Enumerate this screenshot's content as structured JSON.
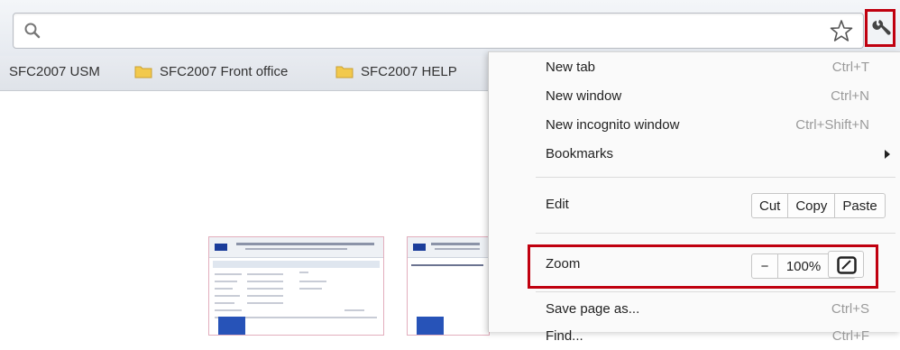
{
  "bookmarks": [
    {
      "label": "SFC2007 USM",
      "icon": "none"
    },
    {
      "label": "SFC2007 Front office",
      "icon": "folder-icon"
    },
    {
      "label": "SFC2007 HELP",
      "icon": "folder-icon"
    }
  ],
  "menu": {
    "new_tab": {
      "label": "New tab",
      "shortcut": "Ctrl+T"
    },
    "new_window": {
      "label": "New window",
      "shortcut": "Ctrl+N"
    },
    "new_incognito": {
      "label": "New incognito window",
      "shortcut": "Ctrl+Shift+N"
    },
    "bookmarks": {
      "label": "Bookmarks"
    },
    "edit": {
      "label": "Edit",
      "cut": "Cut",
      "copy": "Copy",
      "paste": "Paste"
    },
    "zoom": {
      "label": "Zoom",
      "minus": "−",
      "level": "100%",
      "plus": "+"
    },
    "save_page": {
      "label": "Save page as...",
      "shortcut": "Ctrl+S"
    },
    "find": {
      "label": "Find...",
      "shortcut": "Ctrl+F"
    }
  },
  "colors": {
    "highlight": "#c0000f",
    "toolbar": "#e6eaf0",
    "folder": "#f2c94c"
  }
}
